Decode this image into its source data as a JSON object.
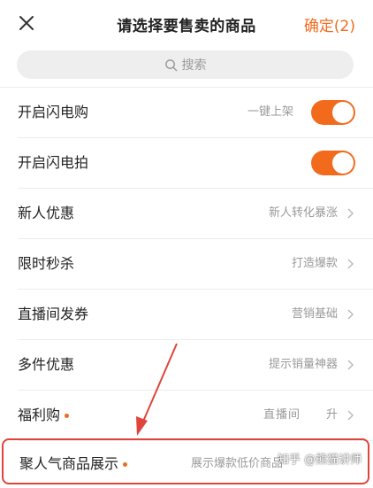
{
  "header": {
    "title": "请选择要售卖的商品",
    "confirm_label": "确定(2)"
  },
  "search": {
    "placeholder": "搜索"
  },
  "rows": [
    {
      "label": "开启闪电购",
      "desc": "一键上架",
      "control": "toggle",
      "toggle_on": true
    },
    {
      "label": "开启闪电拍",
      "desc": "",
      "control": "toggle",
      "toggle_on": true
    },
    {
      "label": "新人优惠",
      "desc": "新人转化暴涨",
      "control": "chevron"
    },
    {
      "label": "限时秒杀",
      "desc": "打造爆款",
      "control": "chevron"
    },
    {
      "label": "直播间发券",
      "desc": "营销基础",
      "control": "chevron"
    },
    {
      "label": "多件优惠",
      "desc": "提示销量神器",
      "control": "chevron"
    },
    {
      "label": "福利购",
      "desc": "直播间",
      "desc_b": "升",
      "control": "chevron",
      "dot": true
    }
  ],
  "highlighted_row": {
    "label": "聚人气商品展示",
    "desc": "展示爆款低价商品",
    "dot": true
  },
  "watermark": "知乎 @熊猫讲师",
  "colors": {
    "accent": "#f26b1d",
    "highlight_border": "#e0443b",
    "arrow": "#e0443b"
  }
}
